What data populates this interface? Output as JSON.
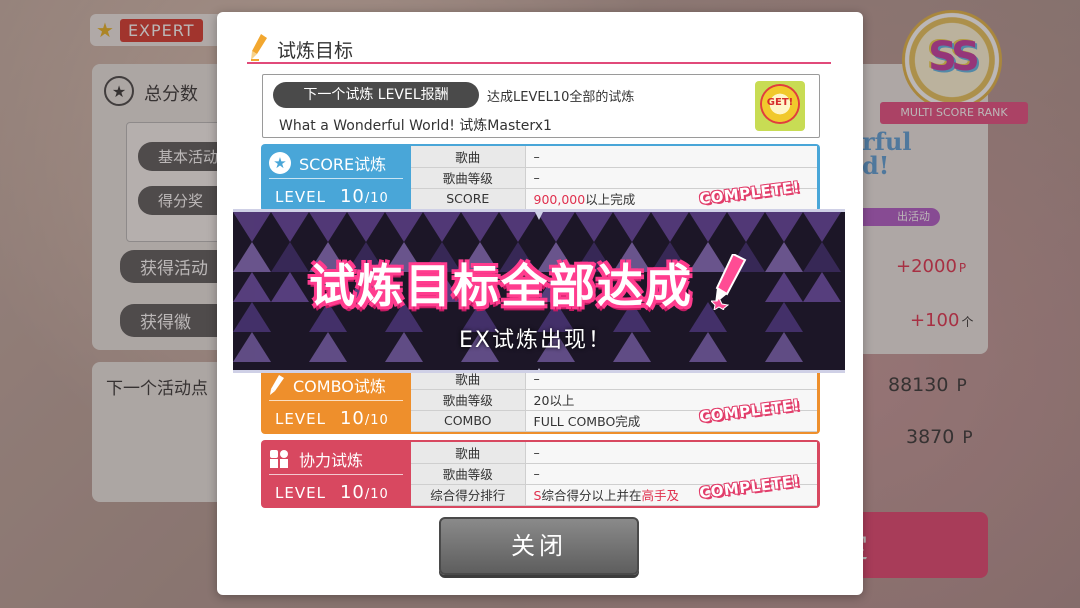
{
  "background": {
    "difficulty": "EXPERT",
    "panel_title": "总分数",
    "panel_items": [
      "基本活动",
      "得分奖"
    ],
    "side_items": [
      "获得活动",
      "获得徽"
    ],
    "lower_label": "下一个活动点",
    "rank_text": "SS",
    "rank_label": "MULTI SCORE RANK",
    "event_tag": "出活动",
    "values": [
      {
        "value": "+2000",
        "unit": "P"
      },
      {
        "value": "+100",
        "unit": "个"
      },
      {
        "value": "88130",
        "unit": "P"
      },
      {
        "value": "3870",
        "unit": "P"
      }
    ],
    "confirm_label": "定"
  },
  "modal": {
    "title": "试炼目标",
    "reward": {
      "pill": "下一个试炼 LEVEL报酬",
      "condition": "达成LEVEL10全部的试炼",
      "song": "What a Wonderful World! 试炼Masterx1",
      "badge": "GET!"
    },
    "trials": [
      {
        "name": "SCORE试炼",
        "level_label": "LEVEL",
        "level": "10",
        "level_max": "/10",
        "rows": [
          {
            "key": "歌曲",
            "value": "–"
          },
          {
            "key": "歌曲等级",
            "value": "–"
          },
          {
            "key": "SCORE",
            "value_red": "900,000",
            "value": "以上完成"
          }
        ],
        "stamp": "COMPLETE!"
      },
      {
        "name": "COMBO试炼",
        "level_label": "LEVEL",
        "level": "10",
        "level_max": "/10",
        "rows": [
          {
            "key": "歌曲",
            "value": "–"
          },
          {
            "key": "歌曲等级",
            "value": "20以上"
          },
          {
            "key": "COMBO",
            "value": "FULL COMBO完成"
          }
        ],
        "stamp": "COMPLETE!"
      },
      {
        "name": "协力试炼",
        "level_label": "LEVEL",
        "level": "10",
        "level_max": "/10",
        "rows": [
          {
            "key": "歌曲",
            "value": "–"
          },
          {
            "key": "歌曲等级",
            "value": "–"
          },
          {
            "key": "综合得分排行",
            "value_red": "S",
            "value": "综合得分以上并在",
            "value_red2": "高手及"
          }
        ],
        "stamp": "COMPLETE!"
      }
    ],
    "close_label": "关闭"
  },
  "banner": {
    "title": "试炼目标全部达成",
    "subtitle": "EX试炼出现！"
  },
  "colors": {
    "accent_pink": "#e14a7a",
    "score_blue": "#49a6d8",
    "combo_orange": "#ee8f2c",
    "coop_red": "#d84860",
    "value_red": "#e0304e"
  },
  "icons": [
    "star-icon",
    "pencil-icon",
    "get-medal-icon",
    "users-icon"
  ]
}
